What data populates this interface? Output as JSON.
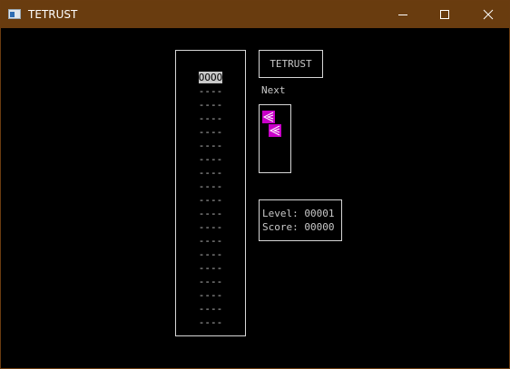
{
  "window": {
    "title": "TETRUST",
    "controls": [
      "minimize-icon",
      "maximize-icon",
      "close-icon"
    ],
    "titlebar_color": "#693c0f"
  },
  "game": {
    "title": "TETRUST",
    "next_label": "Next",
    "well_rows": [
      "OOOO",
      "----",
      "----",
      "----",
      "----",
      "----",
      "----",
      "----",
      "----",
      "----",
      "----",
      "----",
      "----",
      "----",
      "----",
      "----",
      "----",
      "----",
      "----"
    ],
    "active_piece_row": 0,
    "next_piece": {
      "color": "#c800c8",
      "cells": [
        [
          0,
          0
        ],
        [
          1,
          1
        ]
      ]
    },
    "level_label": "Level:",
    "level": "00001",
    "score_label": "Score:",
    "score": "00000"
  }
}
